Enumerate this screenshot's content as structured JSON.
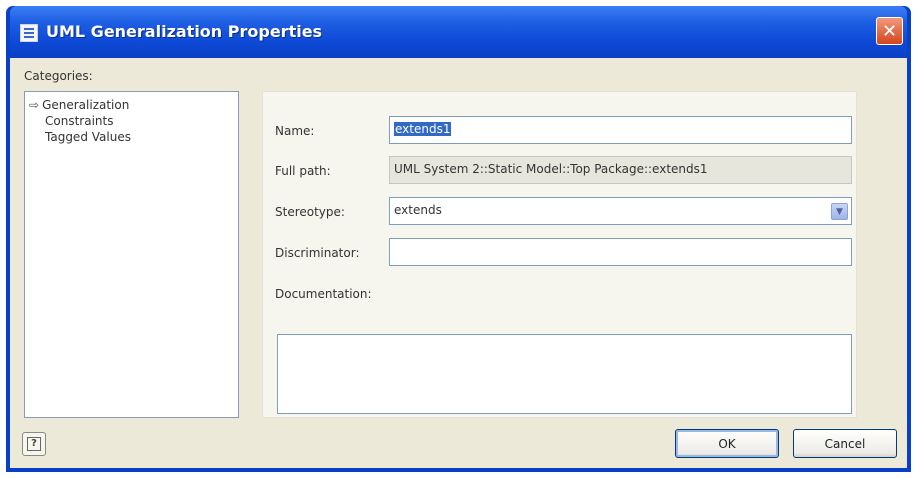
{
  "window": {
    "title": "UML Generalization Properties",
    "close_glyph": "✕"
  },
  "categories": {
    "label": "Categories:",
    "items": [
      {
        "label": "Generalization",
        "selected": true
      },
      {
        "label": "Constraints",
        "selected": false
      },
      {
        "label": "Tagged Values",
        "selected": false
      }
    ]
  },
  "form": {
    "name_label": "Name:",
    "name_value": "extends1",
    "full_path_label": "Full path:",
    "full_path_value": "UML System 2::Static Model::Top Package::extends1",
    "stereotype_label": "Stereotype:",
    "stereotype_value": "extends",
    "discriminator_label": "Discriminator:",
    "discriminator_value": "",
    "documentation_label": "Documentation:",
    "documentation_value": ""
  },
  "buttons": {
    "help_glyph": "?",
    "ok": "OK",
    "cancel": "Cancel"
  },
  "icons": {
    "window": "document-icon",
    "tree_selected": "arrow-right-icon",
    "dropdown": "chevron-down-icon",
    "help": "help-icon"
  },
  "colors": {
    "titlebar": "#0d49d6",
    "close": "#d3451e",
    "selection": "#316ac5",
    "dialog_bg": "#ece9d8"
  }
}
